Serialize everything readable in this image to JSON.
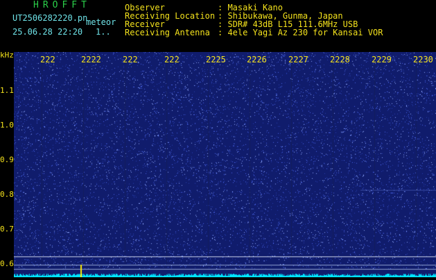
{
  "header": {
    "app_title": "HROFFT",
    "file_name": "UT2506282220.pn",
    "mode": "meteor",
    "date_time": "25.06.28 22:20",
    "count": "1..",
    "info": [
      {
        "key": "Observer",
        "value": ": Masaki Kano"
      },
      {
        "key": "Receiving Location",
        "value": ": Shibukawa, Gunma, Japan"
      },
      {
        "key": "Receiver",
        "value": ": SDR# 43dB L15 111.6MHz USB"
      },
      {
        "key": "Receiving Antenna",
        "value": ": 4ele Yagi Az 230 for Kansai VOR"
      }
    ]
  },
  "axis": {
    "unit": "kHz",
    "time_ticks": [
      "222",
      "2222",
      "222",
      "222",
      "2225",
      "2226",
      "2227",
      "2228",
      "2229",
      "2230"
    ],
    "freq_ticks": [
      "1.1",
      "1.0",
      "0.9",
      "0.8",
      "0.7",
      "0.6"
    ]
  },
  "colors": {
    "header_title": "#2bd14a",
    "header_text": "#6fe3e8",
    "axis_labels": "#f4e21c",
    "waterfall_bg": "#101c6c",
    "noise_dots": "#5a7cff",
    "baseline": "#00e5ff",
    "marker": "#ffee00"
  }
}
